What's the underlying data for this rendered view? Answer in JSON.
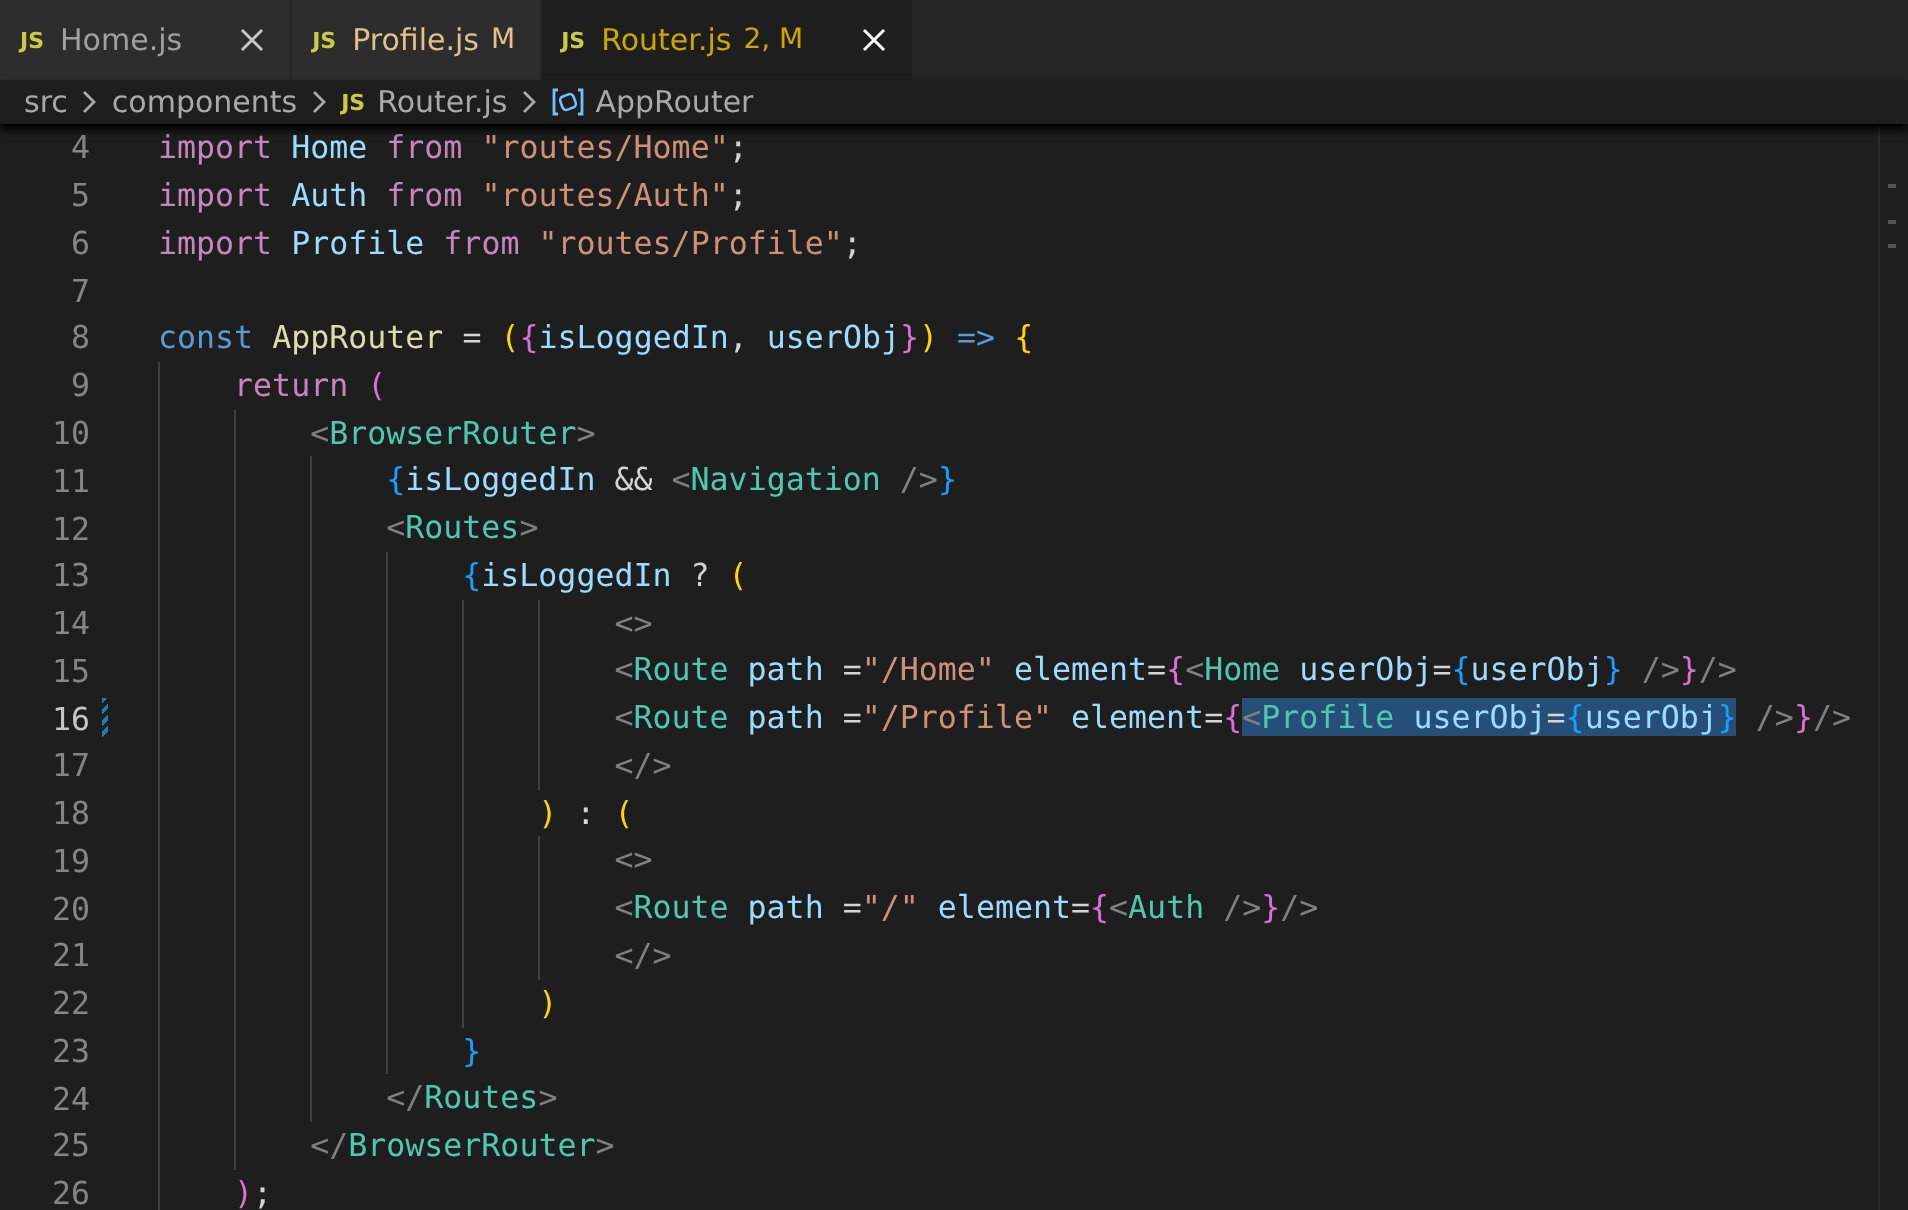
{
  "tabs": [
    {
      "icon": "JS",
      "label": "Home.js",
      "selected": false,
      "close_visible": true,
      "color": "#a0a0a0"
    },
    {
      "icon": "JS",
      "label": "Profile.js",
      "badge": "M",
      "selected": false,
      "close_visible": false,
      "color": "#e2c08d"
    },
    {
      "icon": "JS",
      "label": "Router.js",
      "badge": "2, M",
      "selected": true,
      "close_visible": true,
      "color": "#cca700"
    }
  ],
  "breadcrumb": [
    {
      "label": "src",
      "kind": "folder"
    },
    {
      "label": "components",
      "kind": "folder"
    },
    {
      "label": "Router.js",
      "kind": "js-file",
      "icon": "JS"
    },
    {
      "label": "AppRouter",
      "kind": "symbol"
    }
  ],
  "lines": [
    {
      "number": "4",
      "current": false,
      "modified": false,
      "tokens": [
        {
          "text": "import ",
          "kind": "keyword"
        },
        {
          "text": "Home ",
          "kind": "variable"
        },
        {
          "text": "from ",
          "kind": "keyword"
        },
        {
          "text": "\"routes/Home\"",
          "kind": "string"
        },
        {
          "text": ";",
          "kind": "plain"
        }
      ]
    },
    {
      "number": "5",
      "current": false,
      "modified": false,
      "tokens": [
        {
          "text": "import ",
          "kind": "keyword"
        },
        {
          "text": "Auth ",
          "kind": "variable"
        },
        {
          "text": "from ",
          "kind": "keyword"
        },
        {
          "text": "\"routes/Auth\"",
          "kind": "string"
        },
        {
          "text": ";",
          "kind": "plain"
        }
      ]
    },
    {
      "number": "6",
      "current": false,
      "modified": false,
      "tokens": [
        {
          "text": "import ",
          "kind": "keyword"
        },
        {
          "text": "Profile ",
          "kind": "variable"
        },
        {
          "text": "from ",
          "kind": "keyword"
        },
        {
          "text": "\"routes/Profile\"",
          "kind": "string"
        },
        {
          "text": ";",
          "kind": "plain"
        }
      ]
    },
    {
      "number": "7",
      "current": false,
      "modified": false
    },
    {
      "number": "8",
      "current": false,
      "modified": false,
      "tokens": [
        {
          "text": "const ",
          "kind": "storage"
        },
        {
          "text": "AppRouter",
          "kind": "function"
        },
        {
          "text": " = ",
          "kind": "plain"
        },
        {
          "text": "(",
          "kind": "bracket-gold"
        },
        {
          "text": "{",
          "kind": "bracket-pink"
        },
        {
          "text": "isLoggedIn",
          "kind": "variable"
        },
        {
          "text": ", ",
          "kind": "plain"
        },
        {
          "text": "userObj",
          "kind": "variable"
        },
        {
          "text": "}",
          "kind": "bracket-pink"
        },
        {
          "text": ")",
          "kind": "bracket-gold"
        },
        {
          "text": " => ",
          "kind": "storage"
        },
        {
          "text": "{",
          "kind": "bracket-gold"
        }
      ]
    },
    {
      "number": "9",
      "current": false,
      "modified": false,
      "tokens": [
        {
          "text": "    return ",
          "kind": "keyword"
        },
        {
          "text": "(",
          "kind": "bracket-pink"
        }
      ]
    },
    {
      "number": "10",
      "current": false,
      "modified": false,
      "tokens": [
        {
          "text": "        <",
          "kind": "tag-bracket"
        },
        {
          "text": "BrowserRouter",
          "kind": "component"
        },
        {
          "text": ">",
          "kind": "tag-bracket"
        }
      ]
    },
    {
      "number": "11",
      "current": false,
      "modified": false,
      "tokens": [
        {
          "text": "            {",
          "kind": "bracket-blue"
        },
        {
          "text": "isLoggedIn",
          "kind": "variable"
        },
        {
          "text": " && ",
          "kind": "plain"
        },
        {
          "text": "<",
          "kind": "tag-bracket"
        },
        {
          "text": "Navigation",
          "kind": "component"
        },
        {
          "text": " />",
          "kind": "tag-bracket"
        },
        {
          "text": "}",
          "kind": "bracket-blue"
        }
      ]
    },
    {
      "number": "12",
      "current": false,
      "modified": false,
      "tokens": [
        {
          "text": "            <",
          "kind": "tag-bracket"
        },
        {
          "text": "Routes",
          "kind": "component"
        },
        {
          "text": ">",
          "kind": "tag-bracket"
        }
      ]
    },
    {
      "number": "13",
      "current": false,
      "modified": false,
      "tokens": [
        {
          "text": "                {",
          "kind": "bracket-blue"
        },
        {
          "text": "isLoggedIn",
          "kind": "variable"
        },
        {
          "text": " ? ",
          "kind": "plain"
        },
        {
          "text": "(",
          "kind": "bracket-gold"
        }
      ]
    },
    {
      "number": "14",
      "current": false,
      "modified": false,
      "tokens": [
        {
          "text": "                        <>",
          "kind": "tag-bracket"
        }
      ]
    },
    {
      "number": "15",
      "current": false,
      "modified": false,
      "tokens": [
        {
          "text": "                        <",
          "kind": "tag-bracket"
        },
        {
          "text": "Route ",
          "kind": "component"
        },
        {
          "text": "path",
          "kind": "variable"
        },
        {
          "text": " =",
          "kind": "plain"
        },
        {
          "text": "\"/Home\"",
          "kind": "string"
        },
        {
          "text": " element",
          "kind": "variable"
        },
        {
          "text": "=",
          "kind": "plain"
        },
        {
          "text": "{",
          "kind": "bracket-pink"
        },
        {
          "text": "<",
          "kind": "tag-bracket"
        },
        {
          "text": "Home ",
          "kind": "component"
        },
        {
          "text": "userObj",
          "kind": "variable"
        },
        {
          "text": "=",
          "kind": "plain"
        },
        {
          "text": "{",
          "kind": "bracket-blue"
        },
        {
          "text": "userObj",
          "kind": "variable"
        },
        {
          "text": "}",
          "kind": "bracket-blue"
        },
        {
          "text": " />",
          "kind": "tag-bracket"
        },
        {
          "text": "}",
          "kind": "bracket-pink"
        },
        {
          "text": "/>",
          "kind": "tag-bracket"
        }
      ]
    },
    {
      "number": "16",
      "current": true,
      "modified": true,
      "tokens": [
        {
          "text": "                        <",
          "kind": "tag-bracket"
        },
        {
          "text": "Route ",
          "kind": "component"
        },
        {
          "text": "path",
          "kind": "variable"
        },
        {
          "text": " =",
          "kind": "plain"
        },
        {
          "text": "\"/Profile\"",
          "kind": "string"
        },
        {
          "text": " element",
          "kind": "variable"
        },
        {
          "text": "=",
          "kind": "plain"
        },
        {
          "text": "{",
          "kind": "bracket-pink"
        },
        {
          "text": "<",
          "kind": "tag-bracket",
          "selected": true
        },
        {
          "text": "Profile ",
          "kind": "component",
          "selected": true
        },
        {
          "text": "userObj",
          "kind": "variable",
          "selected": true
        },
        {
          "text": "=",
          "kind": "plain",
          "selected": true
        },
        {
          "text": "{",
          "kind": "bracket-blue",
          "selected": true
        },
        {
          "text": "userObj",
          "kind": "variable",
          "selected": true
        },
        {
          "text": "}",
          "kind": "bracket-blue",
          "selected": true
        },
        {
          "text": " />",
          "kind": "tag-bracket"
        },
        {
          "text": "}",
          "kind": "bracket-pink"
        },
        {
          "text": "/>",
          "kind": "tag-bracket"
        }
      ]
    },
    {
      "number": "17",
      "current": false,
      "modified": false,
      "tokens": [
        {
          "text": "                        </>",
          "kind": "tag-bracket"
        }
      ]
    },
    {
      "number": "18",
      "current": false,
      "modified": false,
      "tokens": [
        {
          "text": "                    )",
          "kind": "bracket-gold"
        },
        {
          "text": " : ",
          "kind": "plain"
        },
        {
          "text": "(",
          "kind": "bracket-gold"
        }
      ]
    },
    {
      "number": "19",
      "current": false,
      "modified": false,
      "tokens": [
        {
          "text": "                        <>",
          "kind": "tag-bracket"
        }
      ]
    },
    {
      "number": "20",
      "current": false,
      "modified": false,
      "tokens": [
        {
          "text": "                        <",
          "kind": "tag-bracket"
        },
        {
          "text": "Route ",
          "kind": "component"
        },
        {
          "text": "path",
          "kind": "variable"
        },
        {
          "text": " =",
          "kind": "plain"
        },
        {
          "text": "\"/\"",
          "kind": "string"
        },
        {
          "text": " element",
          "kind": "variable"
        },
        {
          "text": "=",
          "kind": "plain"
        },
        {
          "text": "{",
          "kind": "bracket-pink"
        },
        {
          "text": "<",
          "kind": "tag-bracket"
        },
        {
          "text": "Auth",
          "kind": "component"
        },
        {
          "text": " />",
          "kind": "tag-bracket"
        },
        {
          "text": "}",
          "kind": "bracket-pink"
        },
        {
          "text": "/>",
          "kind": "tag-bracket"
        }
      ]
    },
    {
      "number": "21",
      "current": false,
      "modified": false,
      "tokens": [
        {
          "text": "                        </>",
          "kind": "tag-bracket"
        }
      ]
    },
    {
      "number": "22",
      "current": false,
      "modified": false,
      "tokens": [
        {
          "text": "                    )",
          "kind": "bracket-gold"
        }
      ]
    },
    {
      "number": "23",
      "current": false,
      "modified": false,
      "tokens": [
        {
          "text": "                }",
          "kind": "bracket-blue"
        }
      ]
    },
    {
      "number": "24",
      "current": false,
      "modified": false,
      "tokens": [
        {
          "text": "            </",
          "kind": "tag-bracket"
        },
        {
          "text": "Routes",
          "kind": "component"
        },
        {
          "text": ">",
          "kind": "tag-bracket"
        }
      ]
    },
    {
      "number": "25",
      "current": false,
      "modified": false,
      "tokens": [
        {
          "text": "        </",
          "kind": "tag-bracket"
        },
        {
          "text": "BrowserRouter",
          "kind": "component"
        },
        {
          "text": ">",
          "kind": "tag-bracket"
        }
      ]
    },
    {
      "number": "26",
      "current": false,
      "modified": false,
      "tokens": [
        {
          "text": "    )",
          "kind": "bracket-pink"
        },
        {
          "text": ";",
          "kind": "plain"
        }
      ]
    }
  ]
}
